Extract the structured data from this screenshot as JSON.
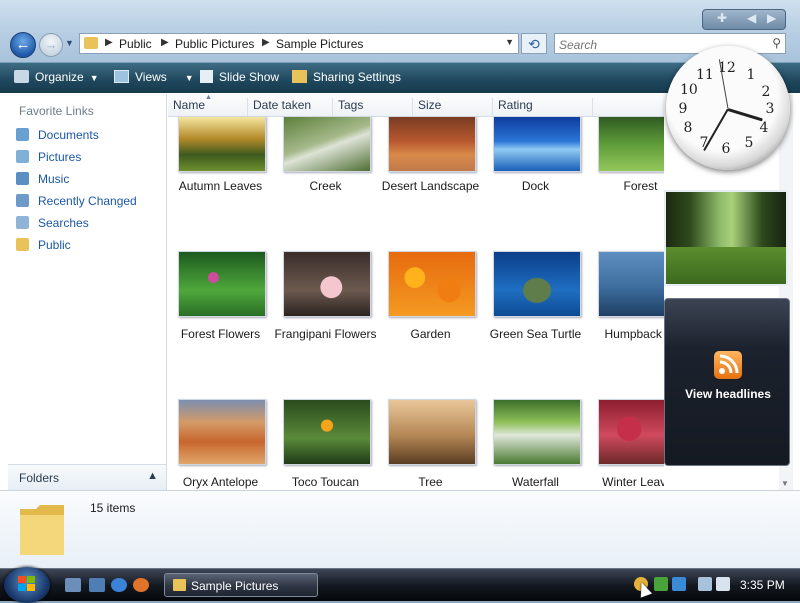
{
  "window": {
    "breadcrumb": [
      "Public",
      "Public Pictures",
      "Sample Pictures"
    ],
    "search_placeholder": "Search"
  },
  "toolbar": {
    "organize": "Organize",
    "views": "Views",
    "slideshow": "Slide Show",
    "sharing": "Sharing Settings"
  },
  "nav": {
    "heading": "Favorite Links",
    "items": [
      {
        "label": "Documents",
        "icon": "documents-icon"
      },
      {
        "label": "Pictures",
        "icon": "pictures-icon"
      },
      {
        "label": "Music",
        "icon": "music-icon"
      },
      {
        "label": "Recently Changed",
        "icon": "recently-changed-icon"
      },
      {
        "label": "Searches",
        "icon": "searches-icon"
      },
      {
        "label": "Public",
        "icon": "folder-icon"
      }
    ],
    "folders_label": "Folders"
  },
  "columns": [
    "Name",
    "Date taken",
    "Tags",
    "Size",
    "Rating"
  ],
  "files": [
    {
      "name": "Autumn Leaves"
    },
    {
      "name": "Creek"
    },
    {
      "name": "Desert Landscape"
    },
    {
      "name": "Dock"
    },
    {
      "name": "Forest"
    },
    {
      "name": "Forest Flowers"
    },
    {
      "name": "Frangipani Flowers"
    },
    {
      "name": "Garden"
    },
    {
      "name": "Green Sea Turtle"
    },
    {
      "name": "Humpback W"
    },
    {
      "name": "Oryx Antelope"
    },
    {
      "name": "Toco Toucan"
    },
    {
      "name": "Tree"
    },
    {
      "name": "Waterfall"
    },
    {
      "name": "Winter Leaves"
    }
  ],
  "details": {
    "count": "15 items"
  },
  "gadgets": {
    "clock_hours": [
      "12",
      "1",
      "2",
      "3",
      "4",
      "5",
      "6",
      "7",
      "8",
      "9",
      "10",
      "11"
    ],
    "feed_label": "View headlines"
  },
  "taskbar": {
    "window_button": "Sample Pictures",
    "time": "3:35 PM"
  },
  "colors": {
    "cmdbar": "#21495f",
    "link": "#1b57a6",
    "rss": "#e6720f"
  }
}
